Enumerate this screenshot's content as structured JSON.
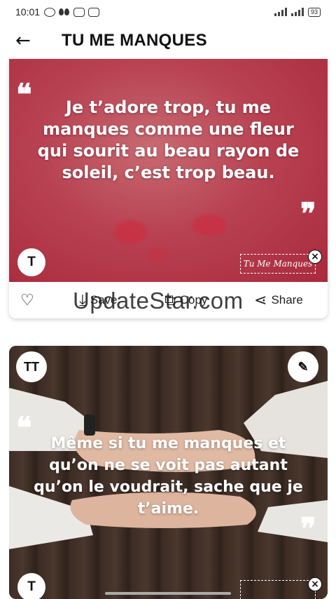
{
  "status": {
    "time": "10:01",
    "battery": "93"
  },
  "header": {
    "back_icon": "arrow-left-icon",
    "title": "TU ME MANQUES"
  },
  "card1": {
    "quote": "Je t’adore trop, tu me manques comme une fleur qui sourit au beau rayon de soleil, c’est trop beau.",
    "text_style_label": "T",
    "watermark": "Tu Me Manques",
    "actions": {
      "like_icon": "heart-icon",
      "save_label": "Save",
      "copy_label": "Copy",
      "share_label": "Share"
    }
  },
  "card2": {
    "quote": "Même si tu me manques et qu’on ne se voit pas autant qu’on le voudrait, sache que je t’aime.",
    "text_style_label": "TT",
    "edit_icon": "pencil-icon",
    "bottom_label": "T"
  },
  "overlay": {
    "watermark": "UpdateStar.com"
  }
}
